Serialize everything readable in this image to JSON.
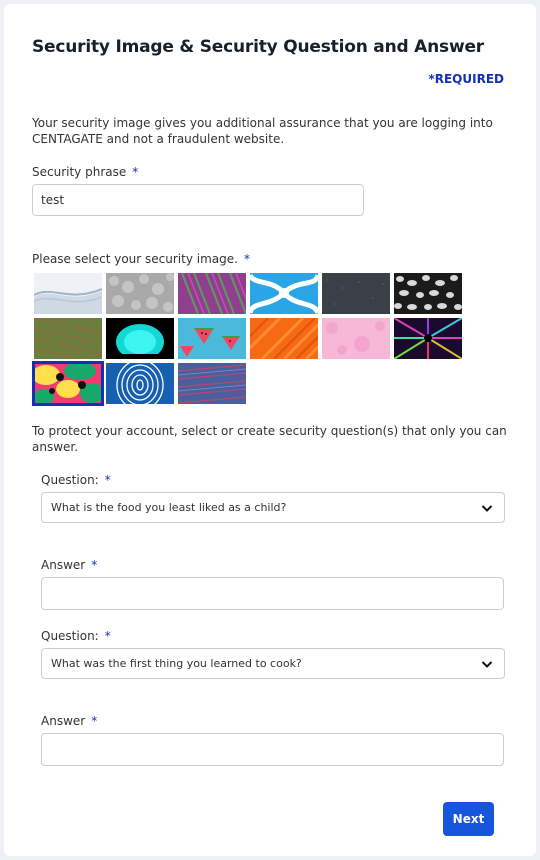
{
  "form": {
    "title": "Security Image & Security Question and Answer",
    "required_note": "*REQUIRED",
    "intro": "Your security image gives you additional assurance that you are logging into CENTAGATE and not a fraudulent website.",
    "phrase_label": "Security phrase",
    "phrase_value": "test",
    "image_label": "Please select your security image.",
    "question_intro": "To protect your account, select or create security question(s) that only you can answer.",
    "required_mark": "*"
  },
  "images": [
    {
      "name": "wave-white",
      "selected": false
    },
    {
      "name": "grey-stone",
      "selected": false
    },
    {
      "name": "purple-green-stripes",
      "selected": false
    },
    {
      "name": "blue-swirl",
      "selected": false
    },
    {
      "name": "dark-grey-texture",
      "selected": false
    },
    {
      "name": "leopard-print",
      "selected": false
    },
    {
      "name": "green-brown-grass",
      "selected": false
    },
    {
      "name": "cyan-glow",
      "selected": false
    },
    {
      "name": "watermelon",
      "selected": false
    },
    {
      "name": "orange-stripes",
      "selected": false
    },
    {
      "name": "pink-texture",
      "selected": false
    },
    {
      "name": "neon-tunnel",
      "selected": false
    },
    {
      "name": "colorful-blobs",
      "selected": true
    },
    {
      "name": "fingerprint",
      "selected": false
    },
    {
      "name": "blue-red-lines",
      "selected": false
    }
  ],
  "questions": [
    {
      "label": "Question:",
      "selected_option": "What is the food you least liked as a child?",
      "answer_label": "Answer",
      "answer_value": ""
    },
    {
      "label": "Question:",
      "selected_option": "What was the first thing you learned to cook?",
      "answer_label": "Answer",
      "answer_value": ""
    }
  ],
  "actions": {
    "next_label": "Next"
  },
  "colors": {
    "accent": "#1230b8",
    "button": "#1756dc",
    "border": "#c9ced6"
  }
}
